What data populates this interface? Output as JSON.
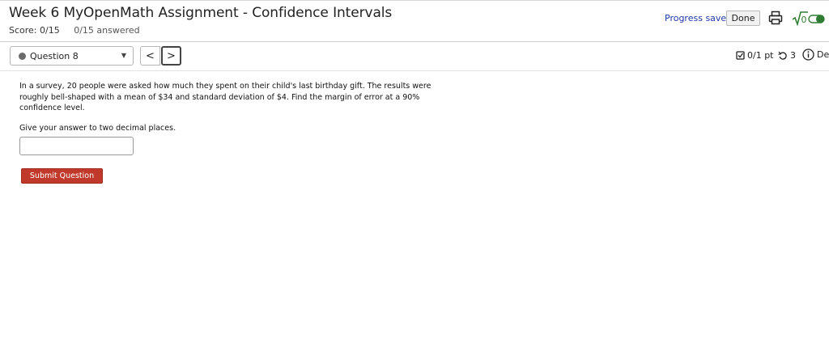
{
  "header": {
    "title": "Week 6 MyOpenMath Assignment - Confidence Intervals",
    "score": "Score: 0/15",
    "answered": "0/15 answered",
    "progress_status": "Progress saved",
    "done_label": "Done",
    "print_icon": "printer-icon",
    "math_entry_toggle": {
      "icon_text": "√0",
      "enabled": true,
      "accent": "#2e7d32"
    }
  },
  "question_nav": {
    "selected_question": "Question 8",
    "prev_label": "<",
    "next_label": ">"
  },
  "question_meta": {
    "points": "0/1 pt",
    "retries": "3",
    "details_label": "Det"
  },
  "question": {
    "text": "In a survey, 20 people were asked how much they spent on their child's last birthday gift. The results were roughly bell-shaped with a mean of $34 and standard deviation of $4. Find the margin of error at a 90% confidence level.",
    "instruction": "Give your answer to two decimal places.",
    "answer_value": "",
    "submit_label": "Submit Question"
  },
  "colors": {
    "submit_button": "#c0392b",
    "progress_text": "#1f3aa8"
  }
}
